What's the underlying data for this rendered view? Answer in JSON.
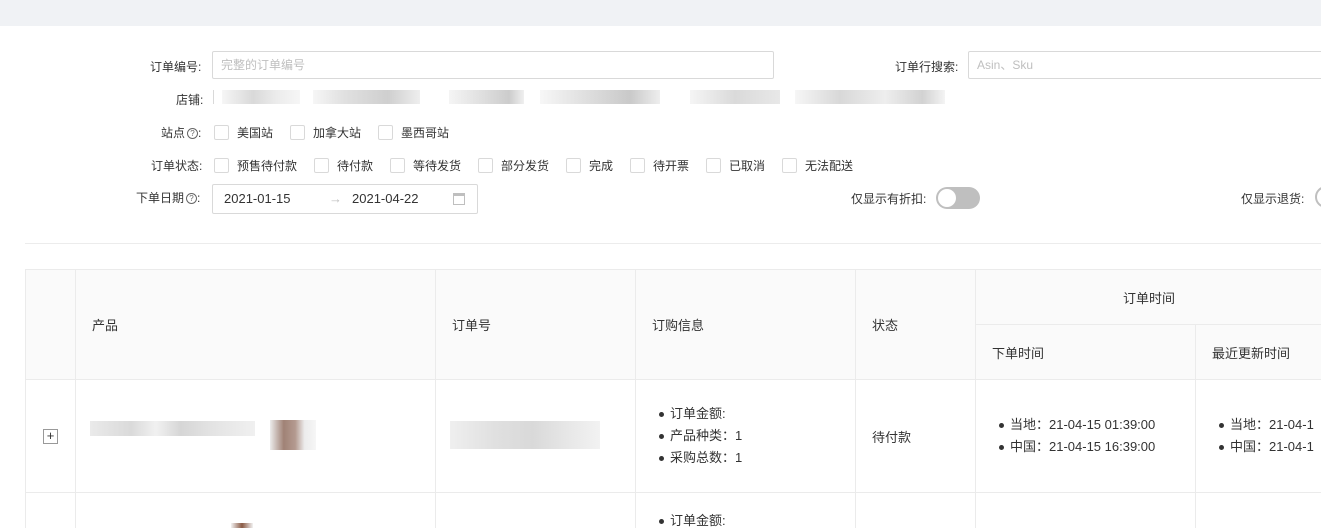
{
  "filters": {
    "order_no_label": "订单编号:",
    "order_no_placeholder": "完整的订单编号",
    "order_line_search_label": "订单行搜索:",
    "order_line_search_placeholder": "Asin、Sku",
    "store_label": "店铺:",
    "site_label": "站点",
    "sites": [
      "美国站",
      "加拿大站",
      "墨西哥站"
    ],
    "status_label": "订单状态:",
    "statuses": [
      "预售待付款",
      "待付款",
      "等待发货",
      "部分发货",
      "完成",
      "待开票",
      "已取消",
      "无法配送"
    ],
    "date_label": "下单日期",
    "date_start": "2021-01-15",
    "date_arrow": "→",
    "date_end": "2021-04-22",
    "discount_only_label": "仅显示有折扣:",
    "discount_only_on": false,
    "returns_only_label": "仅显示退货:"
  },
  "table": {
    "headers": {
      "product": "产品",
      "order_no": "订单号",
      "purchase_info": "订购信息",
      "status": "状态",
      "order_time": "订单时间",
      "placed_time": "下单时间",
      "last_update": "最近更新时间"
    },
    "rows": [
      {
        "purchase_info": [
          "订单金额:",
          "产品种类：1",
          "采购总数：1"
        ],
        "status": "待付款",
        "placed_time": [
          "当地：21-04-15 01:39:00",
          "中国：21-04-15 16:39:00"
        ],
        "last_update": [
          "当地：21-04-1",
          "中国：21-04-1"
        ]
      },
      {
        "purchase_info": [
          "订单金额:"
        ]
      }
    ]
  }
}
